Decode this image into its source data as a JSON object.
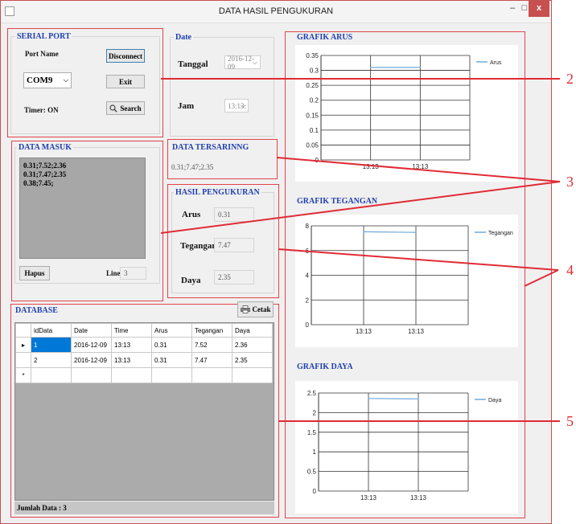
{
  "window": {
    "title": "DATA HASIL PENGUKURAN",
    "min_label": "–",
    "max_label": "□",
    "close_label": "x"
  },
  "serial": {
    "title": "SERIAL PORT",
    "port_name_label": "Port Name",
    "port_value": "COM9",
    "disconnect_label": "Disconnect",
    "exit_label": "Exit",
    "search_label": "Search",
    "timer_label": "Timer: ON"
  },
  "date": {
    "title": "Date",
    "tanggal_label": "Tanggal",
    "tanggal_value": "2016-12-09",
    "jam_label": "Jam",
    "jam_value": "13:13:"
  },
  "data_masuk": {
    "title": "DATA MASUK",
    "lines": [
      "0.31;7.52;2.36",
      "0.31;7.47;2.35",
      "0.38;7.45;"
    ],
    "hapus_label": "Hapus",
    "line_label": "Line",
    "line_value": "3"
  },
  "tersaring": {
    "title": "DATA TERSARINNG",
    "value": "0.31;7.47;2.35"
  },
  "hasil": {
    "title": "HASIL PENGUKURAN",
    "arus_label": "Arus",
    "arus_value": "0.31",
    "tegangan_label": "Tegangan",
    "tegangan_value": "7.47",
    "daya_label": "Daya",
    "daya_value": "2.35"
  },
  "database": {
    "title": "DATABASE",
    "cetak_label": "Cetak",
    "columns": [
      "idData",
      "Date",
      "Time",
      "Arus",
      "Tegangan",
      "Daya"
    ],
    "rows": [
      [
        "1",
        "2016-12-09",
        "13:13",
        "0.31",
        "7.52",
        "2.36"
      ],
      [
        "2",
        "2016-12-09",
        "13:13",
        "0.31",
        "7.47",
        "2.35"
      ]
    ],
    "current_row_marker": "▸",
    "new_row_marker": "*",
    "footer": "Jumlah Data : 3"
  },
  "annotations": [
    "2",
    "3",
    "4",
    "5"
  ],
  "colors": {
    "accent": "#1f3fb0",
    "annotation": "#e02b35",
    "series": "#6fa8dc",
    "selection": "#0078d7"
  },
  "chart_data": [
    {
      "type": "line",
      "title": "GRAFIK ARUS",
      "x": [
        "13:13",
        "13:13"
      ],
      "series": [
        {
          "name": "Arus",
          "values": [
            0.31,
            0.31
          ]
        }
      ],
      "yticks": [
        "0",
        "0.05",
        "0.1",
        "0.15",
        "0.2",
        "0.25",
        "0.3",
        "0.35"
      ],
      "ylim": [
        0,
        0.35
      ],
      "grid": true,
      "legend": "top-right"
    },
    {
      "type": "line",
      "title": "GRAFIK TEGANGAN",
      "x": [
        "13:13",
        "13:13"
      ],
      "series": [
        {
          "name": "Tegangan",
          "values": [
            7.52,
            7.47
          ]
        }
      ],
      "yticks": [
        "0",
        "2",
        "4",
        "6",
        "8"
      ],
      "ylim": [
        0,
        8
      ],
      "grid": true,
      "legend": "top-right"
    },
    {
      "type": "line",
      "title": "GRAFIK DAYA",
      "x": [
        "13:13",
        "13:13"
      ],
      "series": [
        {
          "name": "Daya",
          "values": [
            2.36,
            2.35
          ]
        }
      ],
      "yticks": [
        "0",
        "0.5",
        "1",
        "1.5",
        "2",
        "2.5"
      ],
      "ylim": [
        0,
        2.5
      ],
      "grid": true,
      "legend": "top-right"
    }
  ]
}
